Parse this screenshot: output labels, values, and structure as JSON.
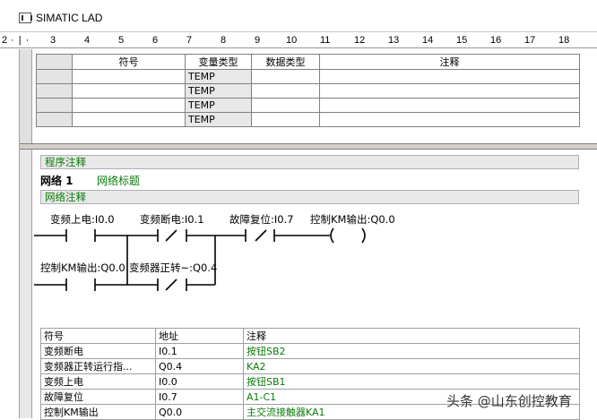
{
  "window": {
    "title": "SIMATIC LAD"
  },
  "ruler": {
    "marks": [
      "2",
      "3",
      "4",
      "5",
      "6",
      "7",
      "8",
      "9",
      "10",
      "11",
      "12",
      "13",
      "14",
      "15",
      "16",
      "17",
      "18"
    ]
  },
  "var_table": {
    "headers": [
      "符号",
      "变量类型",
      "数据类型",
      "注释"
    ],
    "rows": [
      {
        "symbol": "",
        "var_type": "TEMP",
        "data_type": "",
        "comment": ""
      },
      {
        "symbol": "",
        "var_type": "TEMP",
        "data_type": "",
        "comment": ""
      },
      {
        "symbol": "",
        "var_type": "TEMP",
        "data_type": "",
        "comment": ""
      },
      {
        "symbol": "",
        "var_type": "TEMP",
        "data_type": "",
        "comment": ""
      }
    ]
  },
  "program_comment": "程序注释",
  "network": {
    "label": "网络 1",
    "title": "网络标题",
    "comment": "网络注释"
  },
  "ladder": {
    "rung1": [
      {
        "label": "变频上电:I0.0",
        "type": "NO"
      },
      {
        "label": "变频断电:I0.1",
        "type": "NC"
      },
      {
        "label": "故障复位:I0.7",
        "type": "NC"
      },
      {
        "label": "控制KM输出:Q0.0",
        "type": "coil"
      }
    ],
    "rung2": [
      {
        "label": "控制KM输出:Q0.0",
        "type": "NO"
      },
      {
        "label": "变频器正转~:Q0.4",
        "type": "NC"
      }
    ]
  },
  "symbol_table": {
    "headers": [
      "符号",
      "地址",
      "注释"
    ],
    "rows": [
      {
        "symbol": "变频断电",
        "address": "I0.1",
        "comment": "按钮SB2"
      },
      {
        "symbol": "变频器正转运行指...",
        "address": "Q0.4",
        "comment": "KA2"
      },
      {
        "symbol": "变频上电",
        "address": "I0.0",
        "comment": "按钮SB1"
      },
      {
        "symbol": "故障复位",
        "address": "I0.7",
        "comment": "A1-C1"
      },
      {
        "symbol": "控制KM输出",
        "address": "Q0.0",
        "comment": "主交流接触器KA1"
      }
    ]
  },
  "watermark": "头条 @山东创控教育",
  "colors": {
    "comment_green": "#0a7a0a",
    "section_bg": "#e8e8e8"
  }
}
